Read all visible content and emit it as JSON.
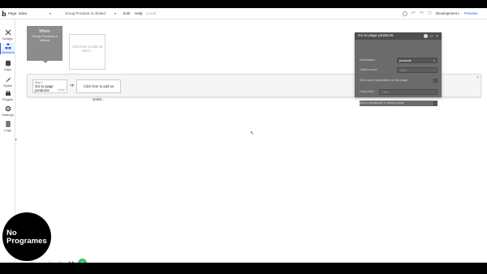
{
  "topbar": {
    "logo": "b",
    "page_label": "Page: index",
    "event_select": "Group Products is clicked",
    "menu_edit": "Edit",
    "menu_help": "Help",
    "menu_credit": "Credit",
    "env_select": "Development",
    "preview": "Preview"
  },
  "sidebar": {
    "items": [
      {
        "label": "Design",
        "icon": "design-icon"
      },
      {
        "label": "Workflow",
        "icon": "workflow-icon"
      },
      {
        "label": "Data",
        "icon": "data-icon"
      },
      {
        "label": "Styles",
        "icon": "styles-icon"
      },
      {
        "label": "Plugins",
        "icon": "plugins-icon"
      },
      {
        "label": "Settings",
        "icon": "settings-icon"
      },
      {
        "label": "Logs",
        "icon": "logs-icon"
      }
    ],
    "active": "Workflow"
  },
  "workflow": {
    "event_when": "When",
    "event_desc": "Group Products is clicked",
    "add_event": "Click here to add an event...",
    "step_number": "Step 1",
    "step_title": "Go to page products",
    "step_delete": "delete",
    "add_action": "Click here to add an action..."
  },
  "panel": {
    "title": "Go to page products",
    "rows": [
      {
        "label": "Destination",
        "value": "products",
        "kind": "select"
      },
      {
        "label": "Data to send",
        "value": "Click",
        "kind": "field"
      },
      {
        "label": "Send more parameters to the page",
        "kind": "checkbox"
      },
      {
        "label": "Only when",
        "value": "Click",
        "kind": "field"
      },
      {
        "label": "Add a breakpoint in debug mode",
        "kind": "checkbox"
      }
    ]
  },
  "watermark": {
    "line1": "No",
    "line2": "Programes"
  },
  "colors": {
    "accent": "#2b5be0",
    "event_card": "#8c8c8c",
    "panel_bg": "#6b6b6b",
    "panel_head": "#4d4d4d",
    "success": "#32c26c"
  }
}
